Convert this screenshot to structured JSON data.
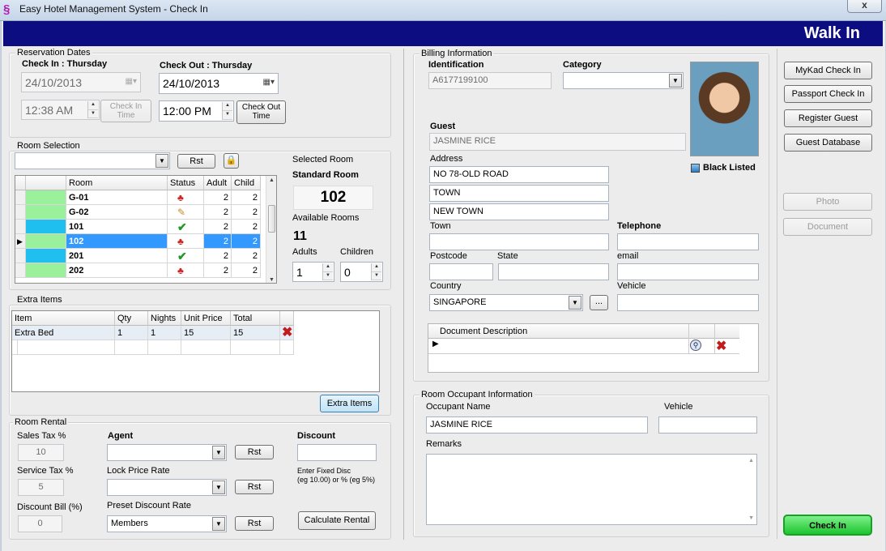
{
  "window": {
    "title": "Easy Hotel Management System - Check In",
    "close": "x"
  },
  "header": {
    "title": "Walk In"
  },
  "reservation": {
    "legend": "Reservation Dates",
    "checkin_label": "Check In : Thursday",
    "checkin_date": "24/10/2013",
    "checkin_time": "12:38 AM",
    "checkin_time_btn": "Check In\nTime",
    "checkout_label": "Check Out : Thursday",
    "checkout_date": "24/10/2013",
    "checkout_time": "12:00 PM",
    "checkout_time_btn": "Check Out\nTime"
  },
  "room_selection": {
    "legend": "Room Selection",
    "rst": "Rst",
    "columns": [
      "Room",
      "Status",
      "Adult",
      "Child"
    ],
    "rows": [
      {
        "room": "G-01",
        "status": "occupied",
        "adult": "2",
        "child": "2",
        "color": "#9bf09b",
        "selected": false
      },
      {
        "room": "G-02",
        "status": "cleaning",
        "adult": "2",
        "child": "2",
        "color": "#9bf09b",
        "selected": false
      },
      {
        "room": "101",
        "status": "available",
        "adult": "2",
        "child": "2",
        "color": "#1fc0f0",
        "selected": false
      },
      {
        "room": "102",
        "status": "occupied",
        "adult": "2",
        "child": "2",
        "color": "#9bf09b",
        "selected": true
      },
      {
        "room": "201",
        "status": "available",
        "adult": "2",
        "child": "2",
        "color": "#1fc0f0",
        "selected": false
      },
      {
        "room": "202",
        "status": "occupied",
        "adult": "2",
        "child": "2",
        "color": "#9bf09b",
        "selected": false
      }
    ],
    "selected_room_label": "Selected Room",
    "room_type": "Standard Room",
    "room_number": "102",
    "available_label": "Available Rooms",
    "available_count": "11",
    "adults_label": "Adults",
    "adults": "1",
    "children_label": "Children",
    "children": "0"
  },
  "extra_items": {
    "legend": "Extra Items",
    "columns": [
      "Item",
      "Qty",
      "Nights",
      "Unit Price",
      "Total"
    ],
    "rows": [
      {
        "item": "Extra Bed",
        "qty": "1",
        "nights": "1",
        "unit_price": "15",
        "total": "15"
      }
    ],
    "button": "Extra Items"
  },
  "room_rental": {
    "legend": "Room Rental",
    "sales_tax_label": "Sales Tax %",
    "sales_tax": "10",
    "service_tax_label": "Service Tax %",
    "service_tax": "5",
    "discount_bill_label": "Discount Bill  (%)",
    "discount_bill": "0",
    "agent_label": "Agent",
    "lock_label": "Lock Price Rate",
    "preset_label": "Preset Discount Rate",
    "preset_value": "Members",
    "rst": "Rst",
    "discount_label": "Discount",
    "discount_hint": "Enter Fixed Disc\n(eg 10.00) or % (eg 5%)",
    "calc_button": "Calculate Rental"
  },
  "billing": {
    "legend": "Billing Information",
    "identification_label": "Identification",
    "identification": "A6177199100",
    "category_label": "Category",
    "guest_label": "Guest",
    "guest": "JASMINE RICE",
    "address_label": "Address",
    "address1": "NO 78-OLD ROAD",
    "address2": "TOWN",
    "address3": "NEW TOWN",
    "town_label": "Town",
    "telephone_label": "Telephone",
    "postcode_label": "Postcode",
    "state_label": "State",
    "email_label": "email",
    "country_label": "Country",
    "country": "SINGAPORE",
    "country_more": "...",
    "vehicle_label": "Vehicle",
    "blacklisted_label": "Black Listed",
    "doc_column": "Document Description"
  },
  "occupant": {
    "legend": "Room Occupant Information",
    "name_label": "Occupant Name",
    "name": "JASMINE RICE",
    "vehicle_label": "Vehicle",
    "remarks_label": "Remarks"
  },
  "side": {
    "mykad": "MyKad Check In",
    "passport": "Passport Check In",
    "register": "Register Guest",
    "database": "Guest Database",
    "photo": "Photo",
    "document": "Document",
    "checkin": "Check In"
  }
}
